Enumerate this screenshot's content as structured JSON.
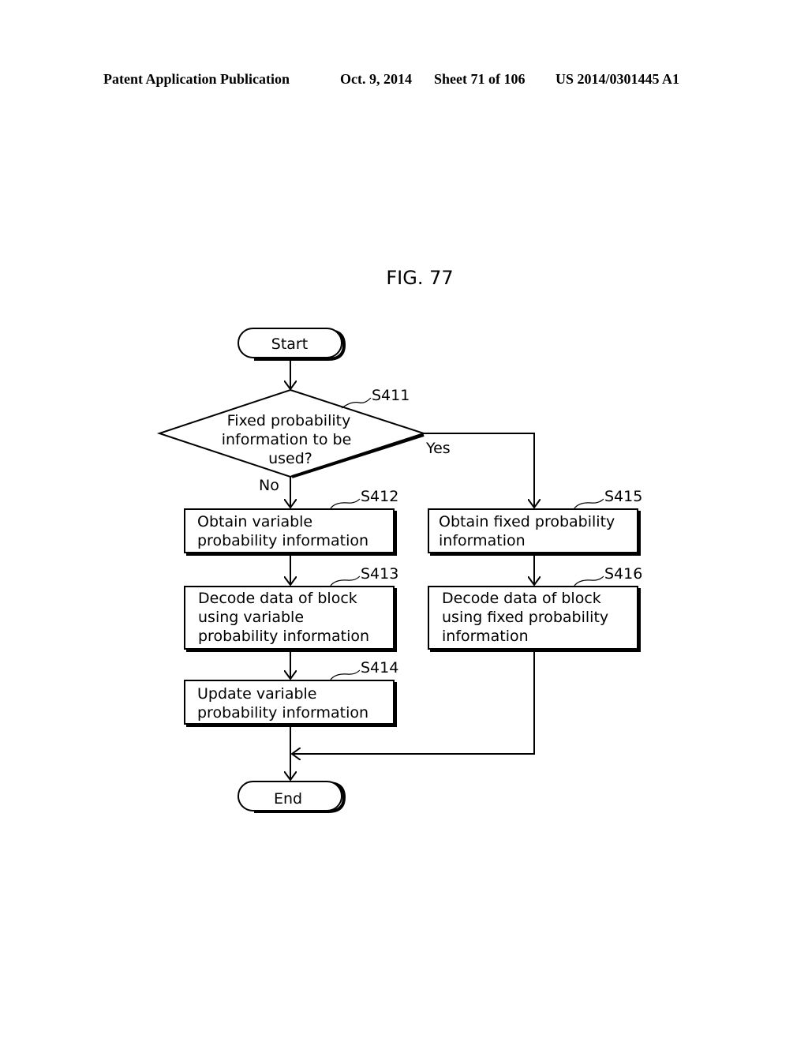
{
  "header": {
    "publication": "Patent Application Publication",
    "date": "Oct. 9, 2014",
    "sheet": "Sheet 71 of 106",
    "number": "US 2014/0301445 A1"
  },
  "figure": {
    "title": "FIG. 77",
    "terminals": {
      "start": "Start",
      "end": "End"
    },
    "decision": {
      "id": "S411",
      "lines": [
        "Fixed probability",
        "information to be",
        "used?"
      ],
      "yes_label": "Yes",
      "no_label": "No"
    },
    "steps": {
      "s412": {
        "id": "S412",
        "lines": [
          "Obtain variable",
          "probability information"
        ]
      },
      "s413": {
        "id": "S413",
        "lines": [
          "Decode data of block",
          "using variable",
          "probability information"
        ]
      },
      "s414": {
        "id": "S414",
        "lines": [
          "Update variable",
          "probability information"
        ]
      },
      "s415": {
        "id": "S415",
        "lines": [
          "Obtain fixed probability",
          "information"
        ]
      },
      "s416": {
        "id": "S416",
        "lines": [
          "Decode data of block",
          "using fixed probability",
          "information"
        ]
      }
    }
  }
}
